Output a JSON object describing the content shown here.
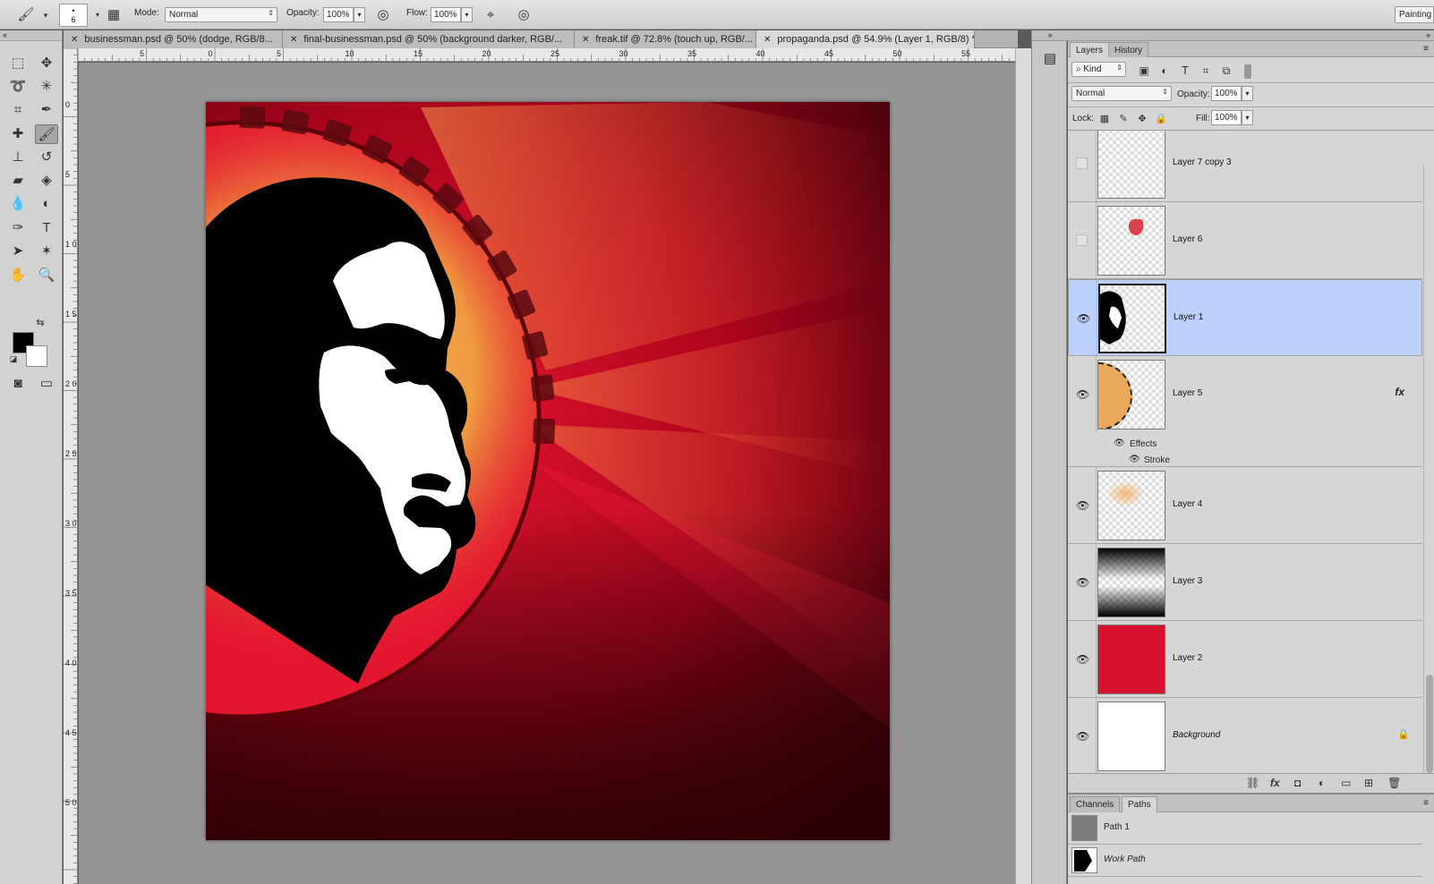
{
  "options": {
    "brush_size": "6",
    "mode_label": "Mode:",
    "mode_value": "Normal",
    "opacity_label": "Opacity:",
    "opacity_value": "100%",
    "flow_label": "Flow:",
    "flow_value": "100%",
    "workspace": "Painting"
  },
  "tabs": [
    {
      "label": "businessman.psd @ 50% (dodge, RGB/8..."
    },
    {
      "label": "final-businessman.psd @ 50% (background darker, RGB/..."
    },
    {
      "label": "freak.tif @ 72.8% (touch up, RGB/..."
    },
    {
      "label": "propaganda.psd @ 54.9% (Layer 1, RGB/8) *"
    }
  ],
  "ruler": {
    "h": [
      "5",
      "0",
      "5",
      "10",
      "15",
      "20",
      "25",
      "30",
      "35",
      "40",
      "45",
      "50",
      "55"
    ],
    "v": [
      "0",
      "5",
      "1 0",
      "1 5",
      "2 0",
      "2 5",
      "3 0",
      "3 5",
      "4 0",
      "4 5",
      "5 0"
    ]
  },
  "layers_panel": {
    "tab_layers": "Layers",
    "tab_history": "History",
    "filter_kind": "Kind",
    "blend_mode": "Normal",
    "opacity_label": "Opacity:",
    "opacity_value": "100%",
    "lock_label": "Lock:",
    "fill_label": "Fill:",
    "fill_value": "100%",
    "layers": [
      {
        "name": "Layer 7 copy 3",
        "visible": false
      },
      {
        "name": "Layer 6",
        "visible": false
      },
      {
        "name": "Layer 1",
        "visible": true,
        "selected": true
      },
      {
        "name": "Layer 5",
        "visible": true,
        "fx": "fx"
      },
      {
        "name": "Layer 4",
        "visible": true
      },
      {
        "name": "Layer 3",
        "visible": true
      },
      {
        "name": "Layer 2",
        "visible": true
      },
      {
        "name": "Background",
        "visible": true,
        "locked": true
      }
    ],
    "effects_label": "Effects",
    "stroke_label": "Stroke"
  },
  "paths_panel": {
    "tab_channels": "Channels",
    "tab_paths": "Paths",
    "paths": [
      {
        "name": "Path 1"
      },
      {
        "name": "Work Path"
      }
    ]
  },
  "colors": {
    "art_red": "#e0142e",
    "art_dark": "#3a0208",
    "glow": "#f4b04a",
    "selected_layer": "#bdd0fb"
  }
}
